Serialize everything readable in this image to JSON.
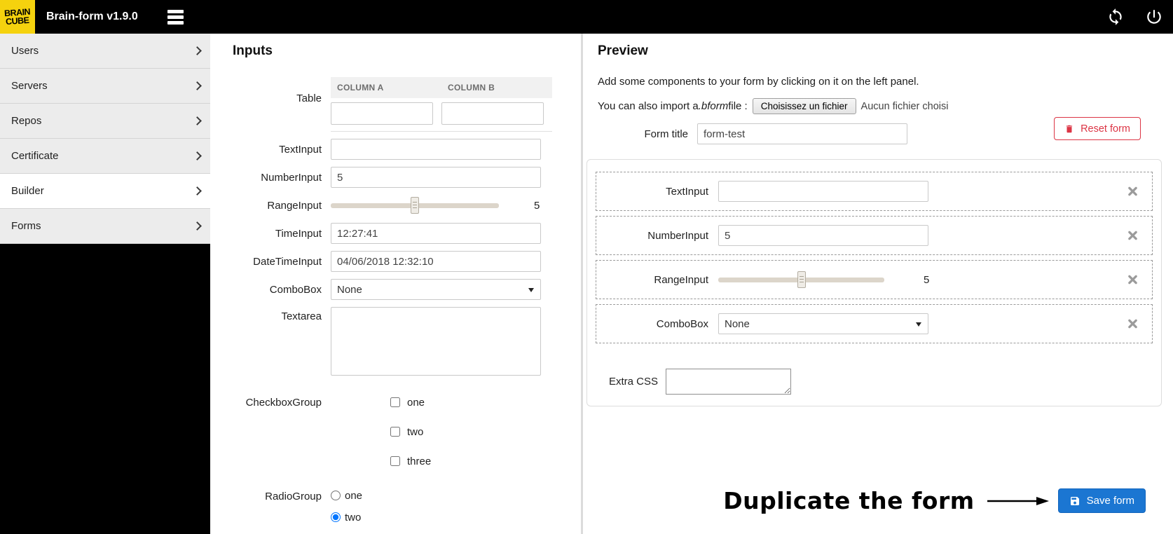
{
  "topbar": {
    "logo": {
      "line1": "BRAIN",
      "line2": "CUBE"
    },
    "app_title": "Brain-form v1.9.0"
  },
  "sidebar": {
    "items": [
      {
        "label": "Users"
      },
      {
        "label": "Servers"
      },
      {
        "label": "Repos"
      },
      {
        "label": "Certificate"
      },
      {
        "label": "Builder",
        "active": true
      },
      {
        "label": "Forms"
      }
    ]
  },
  "inputs_panel": {
    "title": "Inputs",
    "table": {
      "label": "Table",
      "columns": [
        "COLUMN A",
        "COLUMN B"
      ],
      "cells": [
        "",
        ""
      ]
    },
    "text_input": {
      "label": "TextInput",
      "value": ""
    },
    "number_input": {
      "label": "NumberInput",
      "value": "5"
    },
    "range_input": {
      "label": "RangeInput",
      "value": "5"
    },
    "time_input": {
      "label": "TimeInput",
      "value": "12:27:41"
    },
    "datetime_input": {
      "label": "DateTimeInput",
      "value": "04/06/2018 12:32:10"
    },
    "combobox": {
      "label": "ComboBox",
      "value": "None"
    },
    "textarea": {
      "label": "Textarea",
      "value": ""
    },
    "checkbox_group": {
      "label": "CheckboxGroup",
      "options": [
        "one",
        "two",
        "three"
      ],
      "checked": []
    },
    "radio_group": {
      "label": "RadioGroup",
      "options": [
        "one",
        "two"
      ],
      "selected": "two"
    }
  },
  "preview_panel": {
    "title": "Preview",
    "hint": "Add some components to your form by clicking on it on the left panel.",
    "import_prefix": "You can also import a ",
    "import_ext": ".bform",
    "import_suffix": " file :",
    "file_button": "Choisissez un fichier",
    "file_status": "Aucun fichier choisi",
    "form_title_label": "Form title",
    "form_title_value": "form-test",
    "reset_button": "Reset form",
    "components": [
      {
        "label": "TextInput",
        "value": ""
      },
      {
        "label": "NumberInput",
        "value": "5"
      },
      {
        "label": "RangeInput",
        "value": "5"
      },
      {
        "label": "ComboBox",
        "value": "None"
      }
    ],
    "extra_css_label": "Extra CSS",
    "extra_css_value": "",
    "annotation": "Duplicate the form",
    "save_button": "Save form"
  },
  "colors": {
    "brand_yellow": "#f5d20e",
    "danger": "#dc3545",
    "primary": "#1b76d2"
  }
}
